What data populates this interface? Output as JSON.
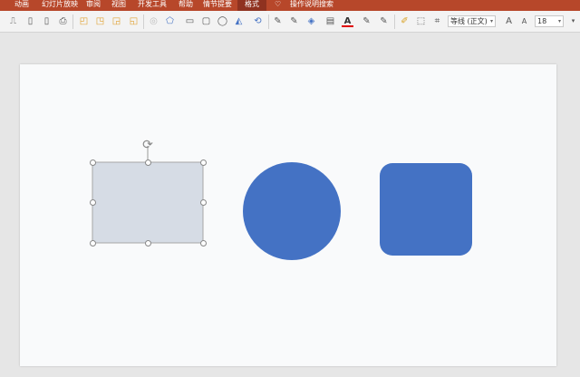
{
  "ribbon": {
    "tabs": [
      "动画",
      "幻灯片放映",
      "审阅",
      "视图",
      "开发工具",
      "帮助",
      "情节提要",
      "格式"
    ],
    "active_tab": "格式",
    "search_label": "操作说明搜索",
    "color": "#b7472a"
  },
  "toolbar": {
    "font_name": "等线 (正文)",
    "font_size": "18",
    "font_color": "#e00000"
  },
  "shapes": [
    {
      "type": "rectangle",
      "fill": "#d6dce5",
      "selected": true
    },
    {
      "type": "circle",
      "fill": "#4472c4"
    },
    {
      "type": "rounded-rectangle",
      "fill": "#4472c4"
    }
  ]
}
